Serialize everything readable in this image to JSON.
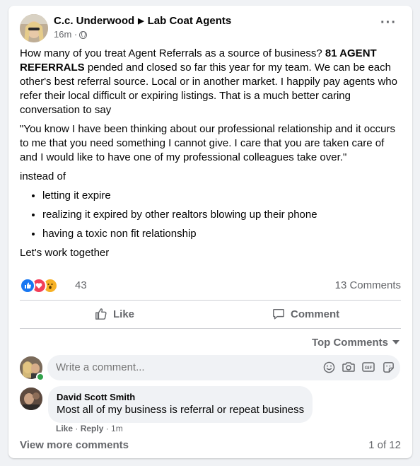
{
  "post": {
    "author": "C.c. Underwood",
    "group": "Lab Coat Agents",
    "time": "16m",
    "privacy_icon": "globe-icon",
    "paragraph1_normal": "How many of you treat Agent Referrals as a source of business? ",
    "paragraph1_bold": "81 AGENT REFERRALS",
    "paragraph1_rest": " pended and closed so far this year for my team. We can be each other's best referral source. Local or in another market. I happily pay agents who refer their local difficult or expiring listings. That is a much better caring conversation to say",
    "quote": "\"You know I have been thinking about our professional relationship and it occurs to me that you need something I cannot give. I care that you are taken care of and I would like to have one of my professional colleagues take over.\"",
    "instead": "instead of",
    "bullets": [
      "letting it expire",
      "realizing it expired by other realtors blowing up their phone",
      "having a toxic non fit relationship"
    ],
    "closing": "Let's work together"
  },
  "stats": {
    "reaction_count": "43",
    "comment_count": "13 Comments",
    "reaction_icons": [
      "like-reaction-icon",
      "love-reaction-icon",
      "wow-reaction-icon"
    ]
  },
  "actions": {
    "like": "Like",
    "comment": "Comment"
  },
  "comments_section": {
    "sort_label": "Top Comments",
    "input_placeholder": "Write a comment...",
    "comment": {
      "author": "David Scott Smith",
      "text": "Most all of my business is referral or repeat business",
      "like": "Like",
      "reply": "Reply",
      "sep": " · ",
      "time": "1m"
    },
    "view_more": "View more comments",
    "pager": "1 of 12"
  },
  "colors": {
    "like_blue": "#1877f2",
    "love_red": "#f33e58",
    "wow_yellow": "#f7b125",
    "secondary_text": "#65676b"
  }
}
